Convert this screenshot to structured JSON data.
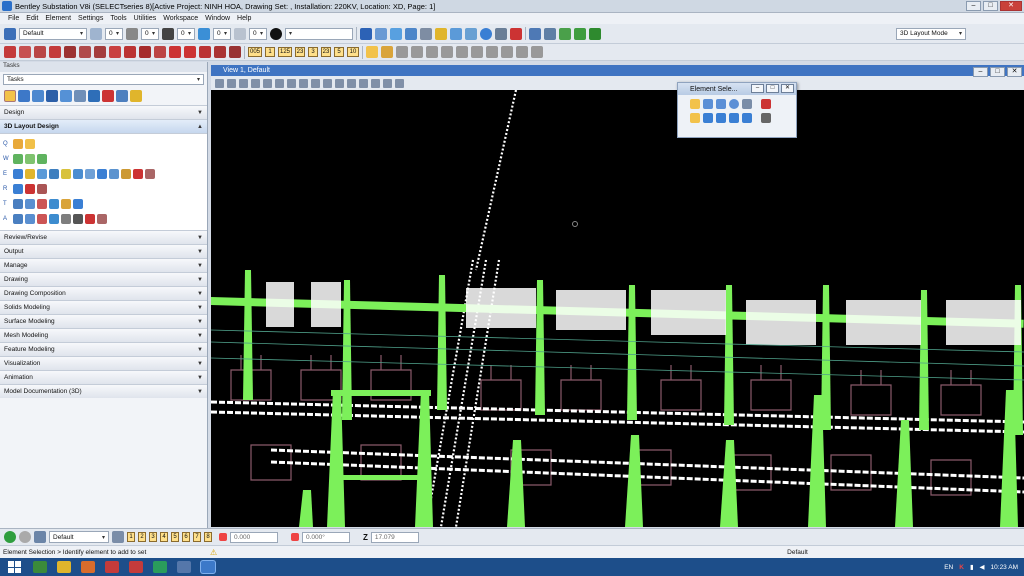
{
  "window": {
    "title": "Bentley Substation V8i (SELECTseries 8)[Active Project: NINH HOA, Drawing Set: , Installation: 220KV, Location: XD, Page: 1]",
    "controls": [
      "–",
      "□",
      "✕"
    ]
  },
  "menu": [
    "File",
    "Edit",
    "Element",
    "Settings",
    "Tools",
    "Utilities",
    "Workspace",
    "Window",
    "Help"
  ],
  "toolbar": {
    "level_combo": "Default",
    "color_value": "0",
    "weight_value": "0",
    "style_value": "0",
    "transparency_value": "0",
    "priority_value": "0",
    "mode_combo": "3D Layout Mode",
    "number_labels": [
      "005",
      "1",
      "125",
      "23",
      "3",
      "23",
      "5",
      "10"
    ]
  },
  "tasks": {
    "panel_title": "Tasks",
    "combo": "Tasks",
    "sections_top": [
      "Design"
    ],
    "active_section": "3D Layout Design",
    "row_keys": [
      "Q",
      "W",
      "E",
      "R",
      "T",
      "A"
    ],
    "sections_bottom": [
      "Review/Revise",
      "Output",
      "Manage",
      "Drawing",
      "Drawing Composition",
      "Solids Modeling",
      "Surface Modeling",
      "Mesh Modeling",
      "Feature Modeling",
      "Visualization",
      "Animation",
      "Model Documentation (3D)"
    ]
  },
  "view": {
    "title": "View 1, Default"
  },
  "element_selection": {
    "title": "Element Sele..."
  },
  "bottom": {
    "level": "Default",
    "view_numbers": [
      "1",
      "2",
      "3",
      "4",
      "5",
      "6",
      "7",
      "8"
    ],
    "x_value": "0.000",
    "angle_value": "0.000°",
    "z_label": "Z",
    "z_value": "17.079"
  },
  "status": {
    "prompt": "Element Selection > Identify element to add to set",
    "level": "Default"
  },
  "taskbar": {
    "lang": "EN",
    "time": "10:23 AM"
  },
  "colors": {
    "structure_green": "#7cf05a",
    "background": "#000000",
    "title_blue": "#3f74c2"
  }
}
